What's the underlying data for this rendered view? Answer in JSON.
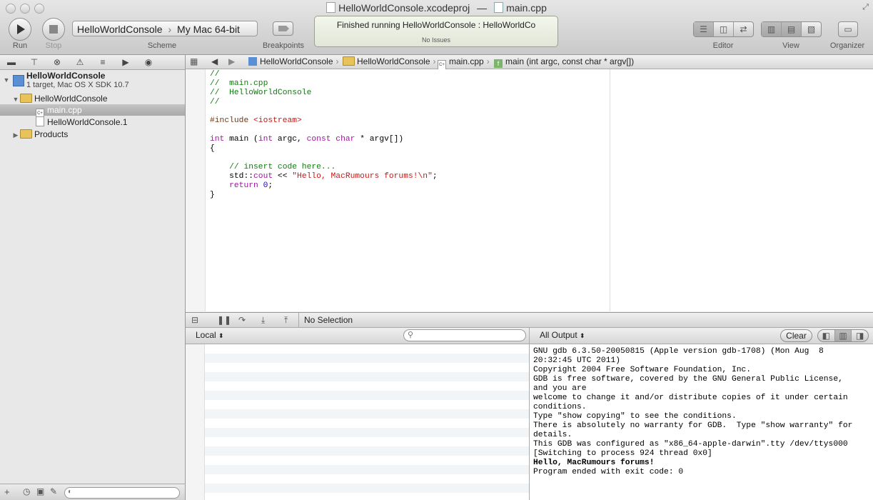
{
  "window": {
    "title_project": "HelloWorldConsole.xcodeproj",
    "title_sep": "—",
    "title_file": "main.cpp"
  },
  "toolbar": {
    "run_label": "Run",
    "stop_label": "Stop",
    "scheme_name": "HelloWorldConsole",
    "scheme_dest": "My Mac 64-bit",
    "scheme_label": "Scheme",
    "breakpoints_label": "Breakpoints",
    "status_main": "Finished running HelloWorldConsole : HelloWorldCo",
    "status_sub": "No Issues",
    "editor_label": "Editor",
    "view_label": "View",
    "organizer_label": "Organizer"
  },
  "navigator": {
    "project_name": "HelloWorldConsole",
    "project_sub": "1 target, Mac OS X SDK 10.7",
    "group": "HelloWorldConsole",
    "file_selected": "main.cpp",
    "file_other": "HelloWorldConsole.1",
    "products": "Products",
    "icons": [
      "folder-icon",
      "hierarchy-icon",
      "search-icon",
      "warning-icon",
      "list-icon",
      "breakpoint-icon",
      "log-icon"
    ]
  },
  "jumpbar": {
    "project": "HelloWorldConsole",
    "group": "HelloWorldConsole",
    "file": "main.cpp",
    "symbol": "main (int argc, const char * argv[])"
  },
  "code": {
    "l1": "//",
    "l2": "//  main.cpp",
    "l3": "//  HelloWorldConsole",
    "l4": "//",
    "l6a": "#include ",
    "l6b": "<iostream>",
    "l8kw": "int",
    "l8a": " main (",
    "l8kw2": "int",
    "l8b": " argc, ",
    "l8kw3": "const char",
    "l8c": " * argv[])",
    "l9": "{",
    "l11": "    // insert code here...",
    "l12a": "    std::",
    "l12kw": "cout",
    "l12b": " << ",
    "l12str": "\"Hello, MacRumours forums!\\n\"",
    "l12c": ";",
    "l13kw": "    return",
    "l13num": " 0",
    "l13c": ";",
    "l14": "}"
  },
  "debug": {
    "no_selection": "No Selection",
    "scope": "Local",
    "output": "All Output",
    "clear": "Clear"
  },
  "console": [
    {
      "t": "GNU gdb 6.3.50-20050815 (Apple version gdb-1708) (Mon Aug  8",
      "b": false
    },
    {
      "t": "20:32:45 UTC 2011)",
      "b": false
    },
    {
      "t": "Copyright 2004 Free Software Foundation, Inc.",
      "b": false
    },
    {
      "t": "GDB is free software, covered by the GNU General Public License,",
      "b": false
    },
    {
      "t": "and you are",
      "b": false
    },
    {
      "t": "welcome to change it and/or distribute copies of it under certain",
      "b": false
    },
    {
      "t": "conditions.",
      "b": false
    },
    {
      "t": "Type \"show copying\" to see the conditions.",
      "b": false
    },
    {
      "t": "There is absolutely no warranty for GDB.  Type \"show warranty\" for",
      "b": false
    },
    {
      "t": "details.",
      "b": false
    },
    {
      "t": "This GDB was configured as \"x86_64-apple-darwin\".tty /dev/ttys000",
      "b": false
    },
    {
      "t": "[Switching to process 924 thread 0x0]",
      "b": false
    },
    {
      "t": "Hello, MacRumours forums!",
      "b": true
    },
    {
      "t": "Program ended with exit code: 0",
      "b": false
    }
  ]
}
